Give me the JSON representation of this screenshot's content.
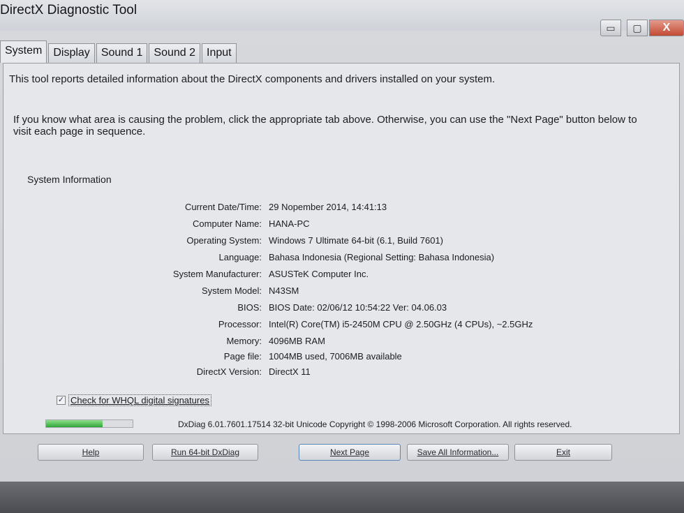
{
  "window": {
    "title": "DirectX Diagnostic Tool",
    "controls": {
      "minimize": "▭",
      "maximize": "▢",
      "close": "X"
    }
  },
  "tabs": [
    {
      "label": "System",
      "active": true
    },
    {
      "label": "Display",
      "active": false
    },
    {
      "label": "Sound 1",
      "active": false
    },
    {
      "label": "Sound 2",
      "active": false
    },
    {
      "label": "Input",
      "active": false
    }
  ],
  "intro": {
    "line1": "This tool reports detailed information about the DirectX components and drivers installed on your system.",
    "line2": "If you know what area is causing the problem, click the appropriate tab above.  Otherwise, you can use the \"Next Page\" button below to visit each page in sequence."
  },
  "system_info": {
    "section_title": "System Information",
    "rows": [
      {
        "label": "Current Date/Time:",
        "value": "29 Nopember 2014, 14:41:13"
      },
      {
        "label": "Computer Name:",
        "value": "HANA-PC"
      },
      {
        "label": "Operating System:",
        "value": "Windows 7 Ultimate 64-bit (6.1, Build 7601)"
      },
      {
        "label": "Language:",
        "value": "Bahasa Indonesia (Regional Setting: Bahasa Indonesia)"
      },
      {
        "label": "System Manufacturer:",
        "value": "ASUSTeK Computer Inc."
      },
      {
        "label": "System Model:",
        "value": "N43SM"
      },
      {
        "label": "BIOS:",
        "value": "BIOS Date: 02/06/12 10:54:22 Ver: 04.06.03"
      },
      {
        "label": "Processor:",
        "value": "Intel(R) Core(TM) i5-2450M CPU @ 2.50GHz (4 CPUs), ~2.5GHz"
      },
      {
        "label": "Memory:",
        "value": "4096MB RAM"
      },
      {
        "label": "Page file:",
        "value": "1004MB used, 7006MB available"
      },
      {
        "label": "DirectX Version:",
        "value": "DirectX 11"
      }
    ]
  },
  "whql": {
    "label": "Check for WHQL digital signatures",
    "checked": true,
    "check_glyph": "✓"
  },
  "progress": {
    "value": 0.65,
    "color": "#2fa53a"
  },
  "footer_text": "DxDiag 6.01.7601.17514 32-bit Unicode  Copyright © 1998-2006 Microsoft Corporation.  All rights reserved.",
  "buttons": {
    "help": "Help",
    "run64": "Run 64-bit DxDiag",
    "next": "Next Page",
    "save": "Save All Information...",
    "exit": "Exit"
  }
}
